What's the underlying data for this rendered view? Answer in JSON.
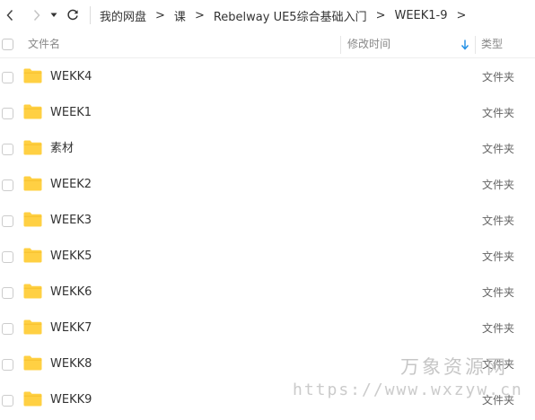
{
  "nav": {
    "back_icon": "chevron-left-icon",
    "forward_icon": "chevron-right-icon",
    "dropdown_icon": "caret-down-icon",
    "refresh_icon": "refresh-icon"
  },
  "breadcrumb": [
    "我的网盘",
    "课",
    "Rebelway UE5综合基础入门",
    "WEEK1-9"
  ],
  "breadcrumb_separator": ">",
  "columns": {
    "name": "文件名",
    "modified": "修改时间",
    "type": "类型"
  },
  "sort": {
    "column": "modified",
    "direction": "descending",
    "accent": "#1f8fe5"
  },
  "files": [
    {
      "name": "WEKK4",
      "type": "文件夹"
    },
    {
      "name": "WEEK1",
      "type": "文件夹"
    },
    {
      "name": "素材",
      "type": "文件夹"
    },
    {
      "name": "WEEK2",
      "type": "文件夹"
    },
    {
      "name": "WEEK3",
      "type": "文件夹"
    },
    {
      "name": "WEKK5",
      "type": "文件夹"
    },
    {
      "name": "WEKK6",
      "type": "文件夹"
    },
    {
      "name": "WEKK7",
      "type": "文件夹"
    },
    {
      "name": "WEKK8",
      "type": "文件夹"
    },
    {
      "name": "WEKK9",
      "type": "文件夹"
    }
  ],
  "folder_color": "#ffd043",
  "watermark": {
    "title": "万象资源网",
    "url": "https://www.wxzyw.cn"
  }
}
